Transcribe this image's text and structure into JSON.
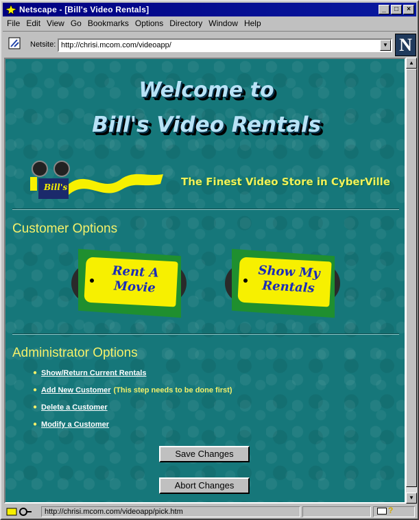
{
  "window": {
    "title": "Netscape - [Bill's Video Rentals]"
  },
  "menu": [
    "File",
    "Edit",
    "View",
    "Go",
    "Bookmarks",
    "Options",
    "Directory",
    "Window",
    "Help"
  ],
  "location": {
    "label": "Netsite:",
    "url": "http://chrisi.mcom.com/videoapp/"
  },
  "page": {
    "welcome_line1": "Welcome to",
    "welcome_line2": "Bill's Video Rentals",
    "logo_text": "Bill's",
    "tagline": "The Finest Video Store in CyberVille",
    "customer_heading": "Customer Options",
    "customer_options": [
      {
        "label_line1": "Rent A",
        "label_line2": "Movie"
      },
      {
        "label_line1": "Show My",
        "label_line2": "Rentals"
      }
    ],
    "admin_heading": "Administrator Options",
    "admin_links": [
      {
        "label": "Show/Return Current Rentals",
        "note": ""
      },
      {
        "label": "Add New Customer",
        "note": "(This step needs to be done first)"
      },
      {
        "label": "Delete a Customer",
        "note": ""
      },
      {
        "label": "Modify a Customer",
        "note": ""
      }
    ],
    "save_button": "Save Changes",
    "abort_button": "Abort Changes"
  },
  "status": {
    "text": "http://chrisi.mcom.com/videoapp/pick.htm"
  },
  "colors": {
    "title_bar": "#000080",
    "page_background": "#16777a",
    "heading_yellow": "#f4f06a",
    "ticket_yellow": "#f7f000",
    "ticket_green": "#1f8f2f",
    "ticket_text": "#1b2cb8"
  }
}
